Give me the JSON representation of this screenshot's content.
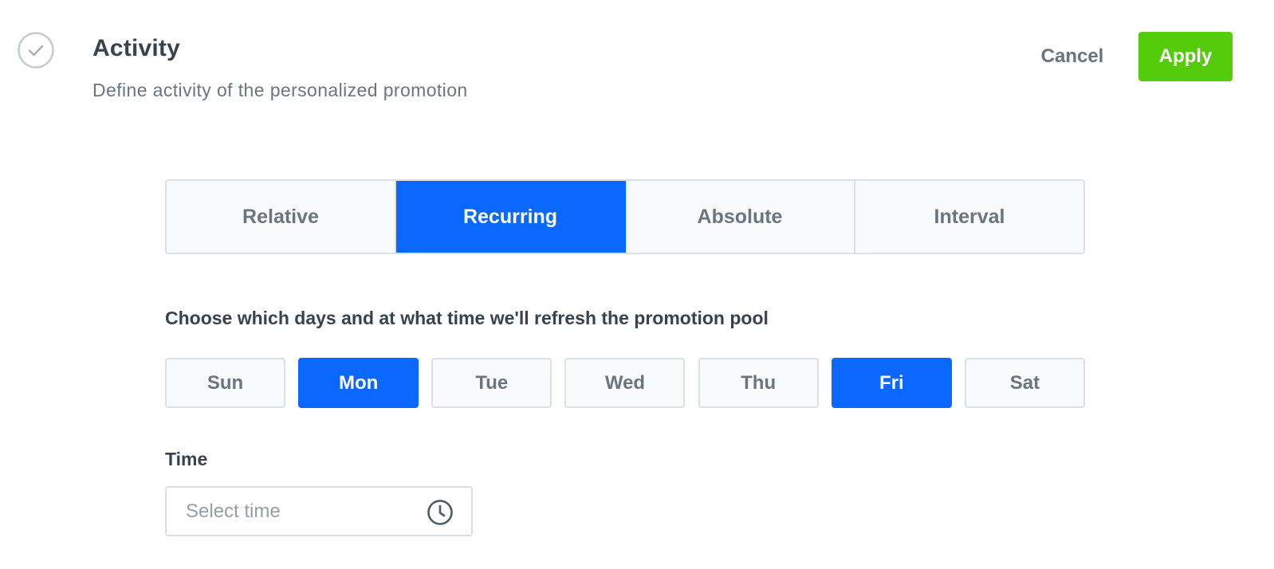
{
  "header": {
    "title": "Activity",
    "subtitle": "Define activity of the personalized promotion",
    "status_icon": "check-circle-icon",
    "cancel_label": "Cancel",
    "apply_label": "Apply"
  },
  "tabs": [
    {
      "label": "Relative",
      "active": false
    },
    {
      "label": "Recurring",
      "active": true
    },
    {
      "label": "Absolute",
      "active": false
    },
    {
      "label": "Interval",
      "active": false
    }
  ],
  "days_section": {
    "label": "Choose which days and at what time we'll refresh the promotion pool",
    "days": [
      {
        "label": "Sun",
        "selected": false
      },
      {
        "label": "Mon",
        "selected": true
      },
      {
        "label": "Tue",
        "selected": false
      },
      {
        "label": "Wed",
        "selected": false
      },
      {
        "label": "Thu",
        "selected": false
      },
      {
        "label": "Fri",
        "selected": true
      },
      {
        "label": "Sat",
        "selected": false
      }
    ]
  },
  "time_section": {
    "label": "Time",
    "value": "",
    "placeholder": "Select time",
    "icon": "clock-icon"
  },
  "colors": {
    "accent": "#0b68ff",
    "apply": "#54cb0b",
    "border": "#dbe0e3",
    "text": "#384350",
    "muted": "#6a7580"
  }
}
